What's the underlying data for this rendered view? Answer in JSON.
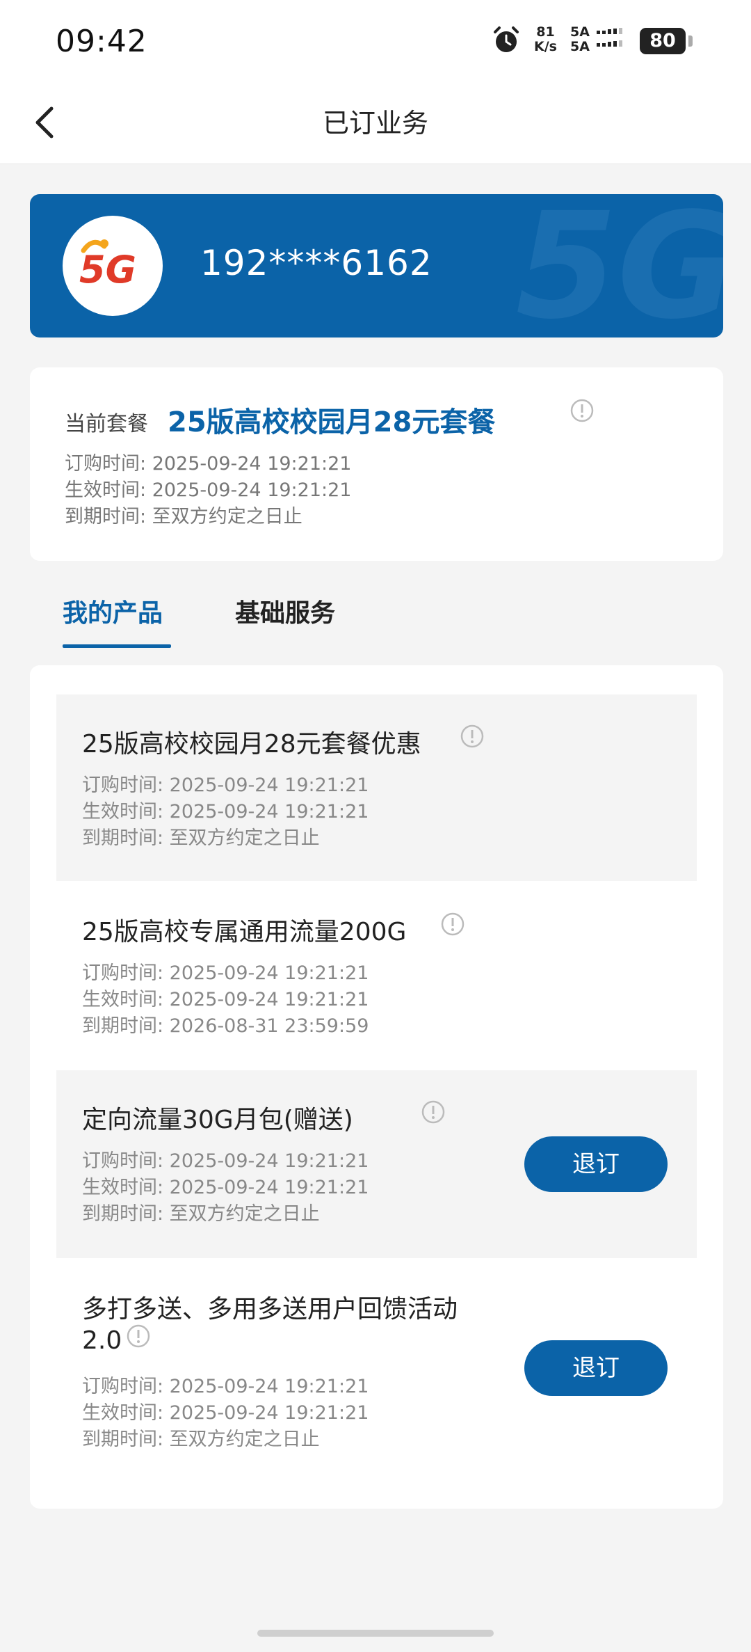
{
  "status_bar": {
    "time": "09:42",
    "net_speed_value": "81",
    "net_speed_unit": "K/s",
    "sim1": "5A",
    "sim2": "5A",
    "battery": "80"
  },
  "nav": {
    "title": "已订业务"
  },
  "account": {
    "logo_text": "5G",
    "phone": "192****6162"
  },
  "current_plan": {
    "label": "当前套餐",
    "name": "25版高校校园月28元套餐",
    "order_label": "订购时间:",
    "order_time": "2025-09-24 19:21:21",
    "effect_label": "生效时间:",
    "effect_time": "2025-09-24 19:21:21",
    "expire_label": "到期时间:",
    "expire_time": "至双方约定之日止"
  },
  "tabs": [
    {
      "label": "我的产品"
    },
    {
      "label": "基础服务"
    }
  ],
  "products": [
    {
      "name": "25版高校校园月28元套餐优惠",
      "order_time": "订购时间:  2025-09-24 19:21:21",
      "effect_time": "生效时间:  2025-09-24 19:21:21",
      "expire_time": "到期时间:  至双方约定之日止"
    },
    {
      "name": "25版高校专属通用流量200G",
      "order_time": "订购时间:  2025-09-24 19:21:21",
      "effect_time": "生效时间:  2025-09-24 19:21:21",
      "expire_time": "到期时间:  2026-08-31 23:59:59"
    },
    {
      "name": "定向流量30G月包(赠送)",
      "order_time": "订购时间:  2025-09-24 19:21:21",
      "effect_time": "生效时间:  2025-09-24 19:21:21",
      "expire_time": "到期时间:  至双方约定之日止",
      "action": "退订"
    },
    {
      "name_line1": "多打多送、多用多送用户回馈活动",
      "name_line2": "2.0",
      "order_time": "订购时间:  2025-09-24 19:21:21",
      "effect_time": "生效时间:  2025-09-24 19:21:21",
      "expire_time": "到期时间:  至双方约定之日止",
      "action": "退订"
    }
  ],
  "colors": {
    "brand_blue": "#0b63a8",
    "background": "#f4f4f4",
    "logo_red": "#e03a28",
    "logo_orange": "#f4a51c"
  }
}
